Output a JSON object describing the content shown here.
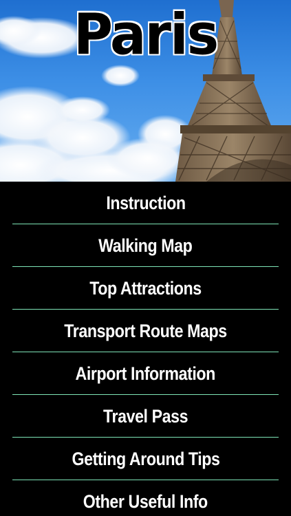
{
  "header": {
    "title": "Paris"
  },
  "menu": {
    "items": [
      {
        "label": "Instruction"
      },
      {
        "label": "Walking Map"
      },
      {
        "label": "Top Attractions"
      },
      {
        "label": "Transport Route Maps"
      },
      {
        "label": "Airport Information"
      },
      {
        "label": "Travel Pass"
      },
      {
        "label": "Getting Around Tips"
      },
      {
        "label": "Other Useful Info"
      }
    ],
    "divider_color": "#7fe6b8"
  },
  "icons": {
    "hero_image": "eiffel-tower-sky-photo"
  }
}
